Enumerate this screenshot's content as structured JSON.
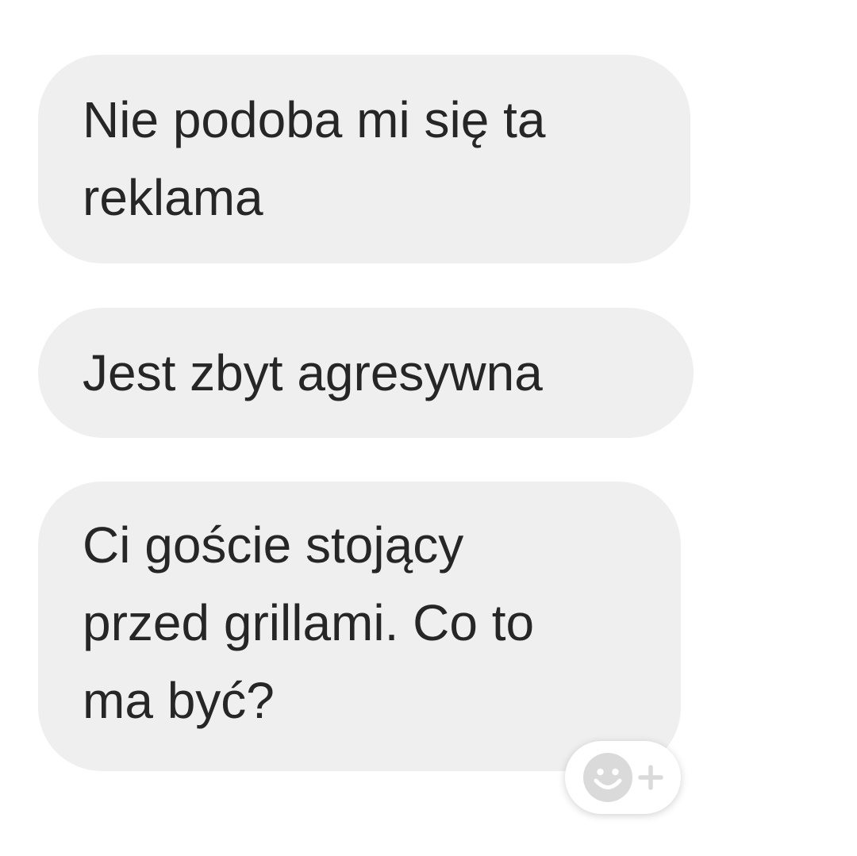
{
  "messages": [
    {
      "text": "Nie podoba mi się ta\nreklama"
    },
    {
      "text": "Jest zbyt agresywna"
    },
    {
      "text": "Ci goście stojący\nprzed grillami. Co to\nma być?"
    }
  ],
  "reaction_button": {
    "icons": [
      "smiley-face-icon",
      "plus-icon"
    ]
  },
  "colors": {
    "bubble_background": "#efefef",
    "text": "#262626",
    "reaction_icon": "#dadada"
  }
}
